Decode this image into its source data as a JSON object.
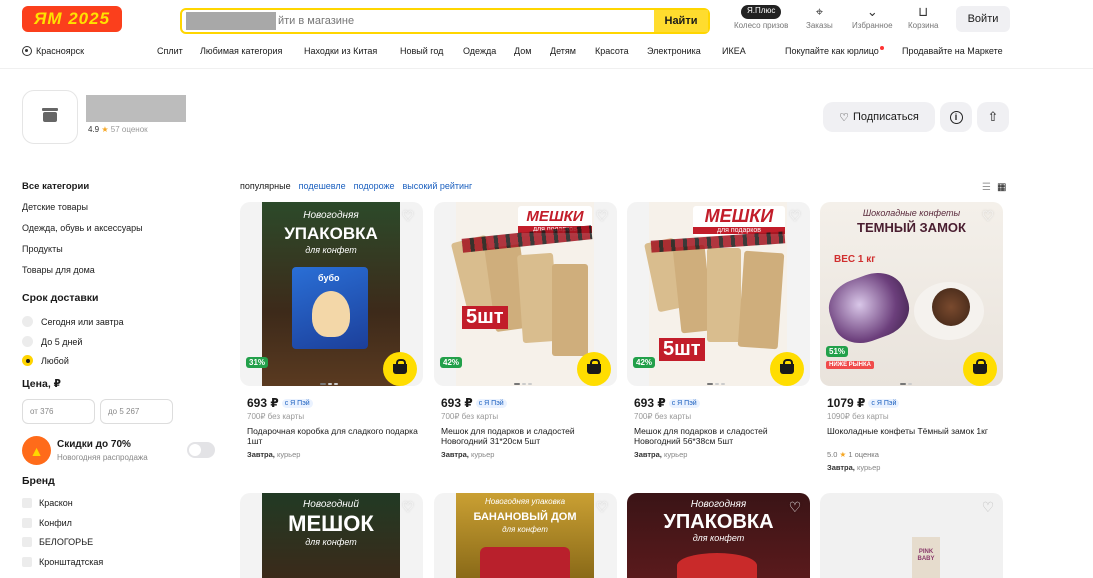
{
  "header": {
    "logo_text": "ЯМ 2025",
    "search_placeholder": "йти в магазине",
    "search_button": "Найти",
    "wheel_badge": "Я.Плюс",
    "wheel_label": "Колесо призов",
    "orders_label": "Заказы",
    "favorites_label": "Избранное",
    "cart_label": "Корзина",
    "login_button": "Войти"
  },
  "nav": {
    "location": "Красноярск",
    "items": [
      "Сплит",
      "Любимая категория",
      "Находки из Китая",
      "Новый год",
      "Одежда",
      "Дом",
      "Детям",
      "Красота",
      "Электроника",
      "ИКЕА"
    ],
    "business": "Покупайте как юрлицо",
    "sell": "Продавайте на Маркете"
  },
  "shop": {
    "rating": "4.9",
    "reviews": "57 оценок",
    "subscribe": "Подписаться"
  },
  "sidebar": {
    "all_categories": "Все категории",
    "categories": [
      "Детские товары",
      "Одежда, обувь и аксессуары",
      "Продукты",
      "Товары для дома"
    ],
    "delivery_title": "Срок доставки",
    "delivery_options": [
      "Сегодня или завтра",
      "До 5 дней",
      "Любой"
    ],
    "price_title": "Цена, ₽",
    "price_from": "от 376",
    "price_to": "до 5 267",
    "sale_title": "Скидки до 70%",
    "sale_sub": "Новогодняя распродажа",
    "brand_title": "Бренд",
    "brands": [
      "Краскон",
      "Конфил",
      "БЕЛОГОРЬЕ",
      "Кронштадтская"
    ]
  },
  "sort": {
    "options": [
      "популярные",
      "подешевле",
      "подороже",
      "высокий рейтинг"
    ]
  },
  "products": [
    {
      "img_top": "Новогодняя",
      "img_big": "УПАКОВКА",
      "img_bottom": "для конфет",
      "img_brand": "бубо",
      "discount": "31%",
      "price": "693 ₽",
      "pay": "с Я Пэй",
      "old_price": "700₽ без карты",
      "title": "Подарочная коробка для сладкого подарка 1шт",
      "delivery_day": "Завтра,",
      "delivery_by": "курьер"
    },
    {
      "img_big": "МЕШКИ",
      "img_sub": "для подарков",
      "img_count": "5шт",
      "discount": "42%",
      "price": "693 ₽",
      "pay": "с Я Пэй",
      "old_price": "700₽ без карты",
      "title": "Мешок для подарков и сладостей Новогодний 31*20см 5шт",
      "delivery_day": "Завтра,",
      "delivery_by": "курьер"
    },
    {
      "img_big": "МЕШКИ",
      "img_sub": "для подарков",
      "img_count": "5шт",
      "discount": "42%",
      "price": "693 ₽",
      "pay": "с Я Пэй",
      "old_price": "700₽ без карты",
      "title": "Мешок для подарков и сладостей Новогодний 56*38см 5шт",
      "delivery_day": "Завтра,",
      "delivery_by": "курьер"
    },
    {
      "img_top": "Шоколадные конфеты",
      "img_big": "ТЕМНЫЙ ЗАМОК",
      "img_weight": "ВЕС 1 кг",
      "discount": "51%",
      "low_badge": "НИЖЕ РЫНКА",
      "price": "1079 ₽",
      "pay": "с Я Пэй",
      "old_price": "1090₽ без карты",
      "title": "Шоколадные конфеты Тёмный замок 1кг",
      "rating": "5.0",
      "rating_count": "1 оценка",
      "delivery_day": "Завтра,",
      "delivery_by": "курьер"
    }
  ],
  "row2": [
    {
      "img_top": "Новогодний",
      "img_big": "МЕШОК",
      "img_bottom": "для конфет"
    },
    {
      "img_top": "Новогодняя упаковка",
      "img_big": "БАНАНОВЫЙ ДОМ",
      "img_bottom": "для конфет"
    },
    {
      "img_top": "Новогодняя",
      "img_big": "УПАКОВКА",
      "img_bottom": "для конфет"
    },
    {
      "img_big": "PINK BABY"
    }
  ],
  "colors": {
    "accent_yellow": "#ffdd00",
    "discount_green": "#22a04a",
    "link_blue": "#1a5fbf"
  }
}
